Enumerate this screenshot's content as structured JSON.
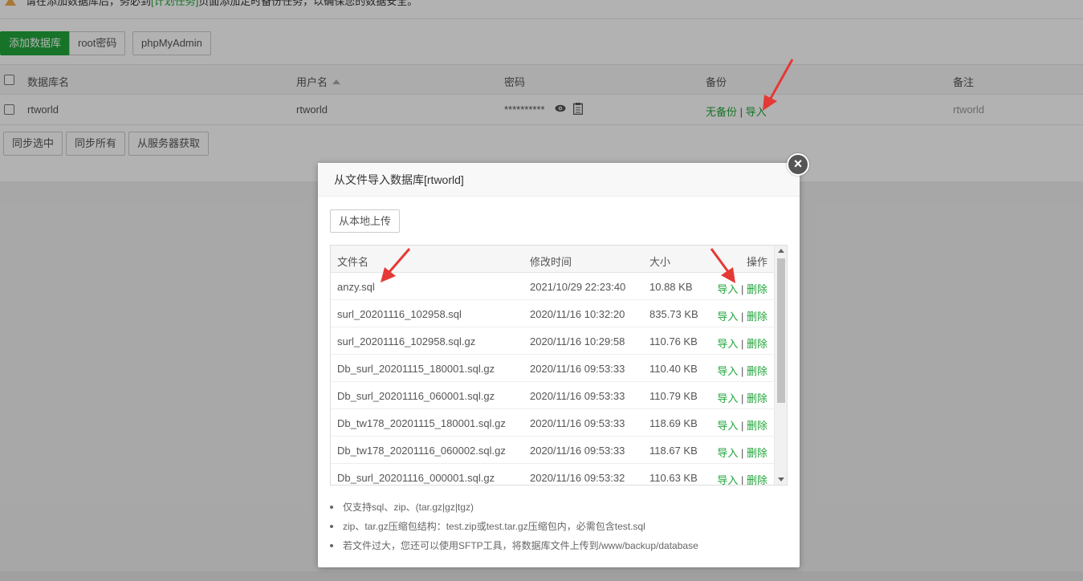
{
  "notice": {
    "text_before": "请在添加数据库后，务必到",
    "link": "[计划任务]",
    "text_after": "页面添加定时备份任务，以确保您的数据安全。"
  },
  "toolbar": {
    "add_db_label": "添加数据库",
    "root_pw_label": "root密码",
    "phpmyadmin_label": "phpMyAdmin"
  },
  "db_table": {
    "headers": {
      "name": "数据库名",
      "user": "用户名",
      "password": "密码",
      "backup": "备份",
      "remark": "备注"
    },
    "rows": [
      {
        "name": "rtworld",
        "user": "rtworld",
        "password": "**********",
        "backup_none": "无备份",
        "backup_sep": "|",
        "backup_import": "导入",
        "remark": "rtworld"
      }
    ]
  },
  "bottom_toolbar": {
    "sync_selected": "同步选中",
    "sync_all": "同步所有",
    "fetch_from_server": "从服务器获取"
  },
  "dialog": {
    "title": "从文件导入数据库[rtworld]",
    "close_symbol": "×",
    "upload_label": "从本地上传",
    "file_table": {
      "headers": {
        "name": "文件名",
        "mtime": "修改时间",
        "size": "大小",
        "ops": "操作"
      },
      "op_import": "导入",
      "op_sep": "|",
      "op_delete": "删除",
      "rows": [
        {
          "name": "anzy.sql",
          "mtime": "2021/10/29 22:23:40",
          "size": "10.88 KB"
        },
        {
          "name": "surl_20201116_102958.sql",
          "mtime": "2020/11/16 10:32:20",
          "size": "835.73 KB"
        },
        {
          "name": "surl_20201116_102958.sql.gz",
          "mtime": "2020/11/16 10:29:58",
          "size": "110.76 KB"
        },
        {
          "name": "Db_surl_20201115_180001.sql.gz",
          "mtime": "2020/11/16 09:53:33",
          "size": "110.40 KB"
        },
        {
          "name": "Db_surl_20201116_060001.sql.gz",
          "mtime": "2020/11/16 09:53:33",
          "size": "110.79 KB"
        },
        {
          "name": "Db_tw178_20201115_180001.sql.gz",
          "mtime": "2020/11/16 09:53:33",
          "size": "118.69 KB"
        },
        {
          "name": "Db_tw178_20201116_060002.sql.gz",
          "mtime": "2020/11/16 09:53:33",
          "size": "118.67 KB"
        },
        {
          "name": "Db_surl_20201116_000001.sql.gz",
          "mtime": "2020/11/16 09:53:32",
          "size": "110.63 KB"
        }
      ]
    },
    "tips": [
      "仅支持sql、zip、(tar.gz|gz|tgz)",
      "zip、tar.gz压缩包结构：test.zip或test.tar.gz压缩包内，必需包含test.sql",
      "若文件过大，您还可以使用SFTP工具，将数据库文件上传到/www/backup/database"
    ]
  },
  "colors": {
    "accent_green": "#20a53a",
    "annotation_red": "#e53935"
  }
}
